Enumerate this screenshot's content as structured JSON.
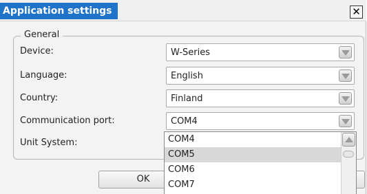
{
  "window": {
    "title": "Application settings",
    "close_label": "✕"
  },
  "general": {
    "legend": "General",
    "fields": [
      {
        "label": "Device:",
        "value": "W-Series"
      },
      {
        "label": "Language:",
        "value": "English"
      },
      {
        "label": "Country:",
        "value": "Finland"
      },
      {
        "label": "Communication port:",
        "value": "COM4"
      },
      {
        "label": "Unit System:",
        "value": ""
      }
    ]
  },
  "dropdown": {
    "options": [
      "COM4",
      "COM5",
      "COM6",
      "COM7"
    ],
    "highlighted": "COM5"
  },
  "buttons": {
    "ok_label": "OK"
  },
  "icons": {
    "close": "close-icon",
    "combo_arrow": "chevron-down-icon",
    "scroll_up": "chevron-up-icon"
  },
  "colors": {
    "title_highlight": "#1f74c9",
    "selected_option": "#d8d8d8"
  }
}
